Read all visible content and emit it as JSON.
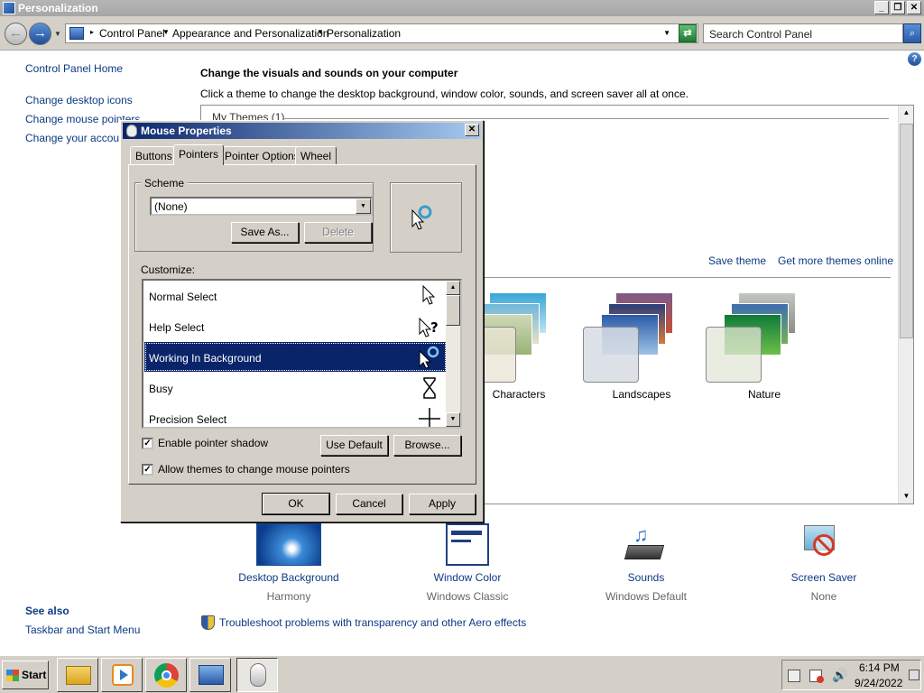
{
  "window": {
    "title": "Personalization",
    "controls": {
      "minimize": "_",
      "maximize": "❐",
      "close": "✕"
    }
  },
  "address": {
    "breadcrumbs": [
      "Control Panel",
      "Appearance and Personalization",
      "Personalization"
    ],
    "search_placeholder": "Search Control Panel"
  },
  "sidebar": {
    "items": [
      {
        "label": "Control Panel Home"
      },
      {
        "label": "Change desktop icons"
      },
      {
        "label": "Change mouse pointers"
      },
      {
        "label": "Change your account"
      }
    ],
    "see_also": {
      "heading": "See also",
      "items": [
        {
          "label": "Taskbar and Start Menu"
        }
      ]
    }
  },
  "main": {
    "heading": "Change the visuals and sounds on your computer",
    "subheading": "Click a theme to change the desktop background, window color, sounds, and screen saver all at once.",
    "my_themes_label": "My Themes (1)",
    "save_theme": "Save theme",
    "get_more_themes": "Get more themes online",
    "themes": [
      {
        "label": "Characters"
      },
      {
        "label": "Landscapes"
      },
      {
        "label": "Nature"
      }
    ],
    "bottom_items": [
      {
        "label": "Desktop Background",
        "sub": "Harmony"
      },
      {
        "label": "Window Color",
        "sub": "Windows Classic"
      },
      {
        "label": "Sounds",
        "sub": "Windows Default"
      },
      {
        "label": "Screen Saver",
        "sub": "None"
      }
    ],
    "troubleshoot_link": "Troubleshoot problems with transparency and other Aero effects"
  },
  "dialog": {
    "title": "Mouse Properties",
    "close": "✕",
    "tabs": [
      {
        "label": "Buttons",
        "active": false
      },
      {
        "label": "Pointers",
        "active": true
      },
      {
        "label": "Pointer Options",
        "active": false
      },
      {
        "label": "Wheel",
        "active": false
      }
    ],
    "scheme_label": "Scheme",
    "scheme_value": "(None)",
    "save_as": "Save As...",
    "delete": "Delete",
    "customize_label": "Customize:",
    "cursors": [
      {
        "label": "Normal Select",
        "icon": "arrow-cursor-icon",
        "selected": false
      },
      {
        "label": "Help Select",
        "icon": "help-cursor-icon",
        "selected": false
      },
      {
        "label": "Working In Background",
        "icon": "working-cursor-icon",
        "selected": true
      },
      {
        "label": "Busy",
        "icon": "hourglass-cursor-icon",
        "selected": false
      },
      {
        "label": "Precision Select",
        "icon": "crosshair-cursor-icon",
        "selected": false
      }
    ],
    "enable_shadow": {
      "label": "Enable pointer shadow",
      "checked": true
    },
    "allow_themes": {
      "label": "Allow themes to change mouse pointers",
      "checked": true
    },
    "use_default": "Use Default",
    "browse": "Browse...",
    "ok": "OK",
    "cancel": "Cancel",
    "apply": "Apply"
  },
  "taskbar": {
    "start_label": "Start",
    "apps": [
      "file-explorer-icon",
      "media-player-icon",
      "chrome-icon",
      "control-panel-icon",
      "mouse-properties-icon"
    ],
    "clock_time": "6:14 PM",
    "clock_date": "9/24/2022"
  },
  "colors": {
    "link": "#0c3a82",
    "dialog_title_start": "#0a246a",
    "dialog_title_end": "#a6caf0",
    "selection": "#0a246a",
    "face": "#d4d0c8"
  }
}
